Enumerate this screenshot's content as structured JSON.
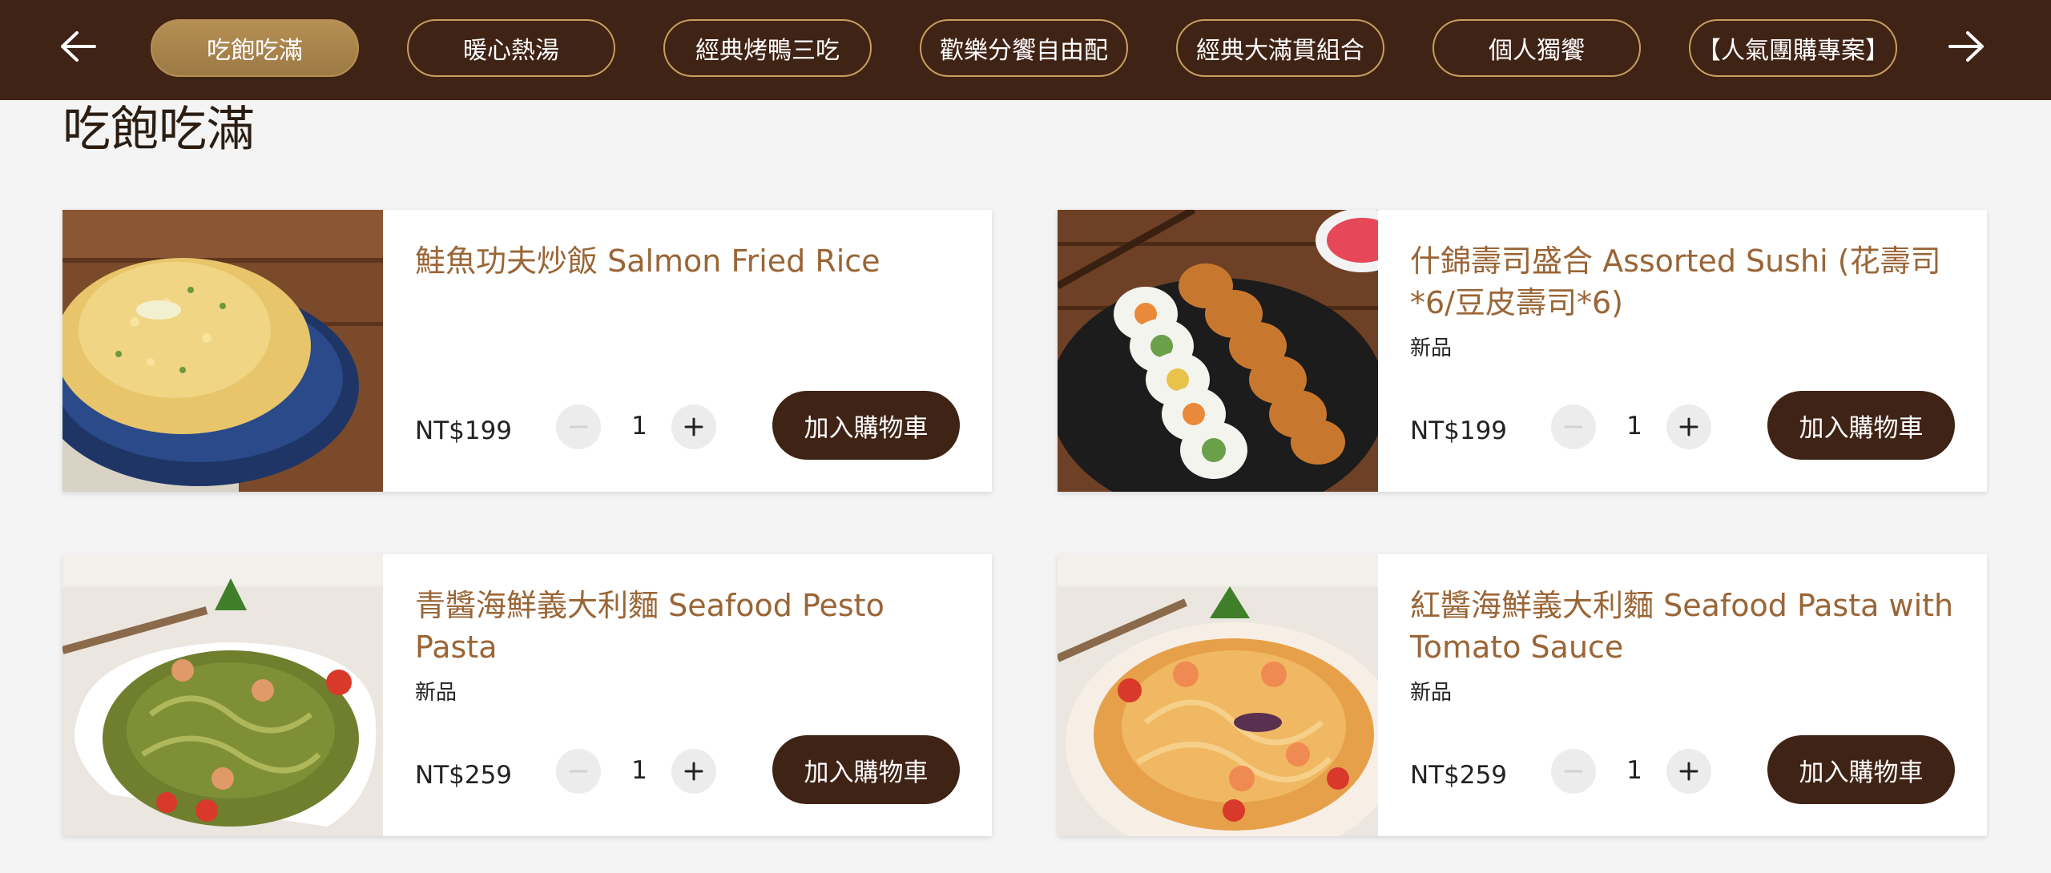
{
  "nav": {
    "prev_icon": "arrow-left-icon",
    "next_icon": "arrow-right-icon",
    "tabs": [
      {
        "label": "吃飽吃滿",
        "active": true
      },
      {
        "label": "暖心熱湯",
        "active": false
      },
      {
        "label": "經典烤鴨三吃",
        "active": false
      },
      {
        "label": "歡樂分饗自由配",
        "active": false
      },
      {
        "label": "經典大滿貫組合",
        "active": false
      },
      {
        "label": "個人獨饗",
        "active": false
      },
      {
        "label": "【人氣團購專案】",
        "active": false
      }
    ]
  },
  "section": {
    "title": "吃飽吃滿"
  },
  "products": [
    {
      "name": "鮭魚功夫炒飯 Salmon Fried Rice",
      "badge": "",
      "price": "NT$199",
      "quantity": "1",
      "add_label": "加入購物車",
      "image": "fried-rice-image"
    },
    {
      "name": "什錦壽司盛合 Assorted Sushi (花壽司*6/豆皮壽司*6)",
      "badge": "新品",
      "price": "NT$199",
      "quantity": "1",
      "add_label": "加入購物車",
      "image": "sushi-image"
    },
    {
      "name": "青醬海鮮義大利麵 Seafood Pesto Pasta",
      "badge": "新品",
      "price": "NT$259",
      "quantity": "1",
      "add_label": "加入購物車",
      "image": "pesto-pasta-image"
    },
    {
      "name": "紅醬海鮮義大利麵 Seafood Pasta with Tomato Sauce",
      "badge": "新品",
      "price": "NT$259",
      "quantity": "1",
      "add_label": "加入購物車",
      "image": "tomato-pasta-image"
    }
  ],
  "colors": {
    "header_bg": "#3f2315",
    "accent_gold": "#b58f54",
    "product_name": "#9a6536",
    "page_bg": "#f4f4f4"
  }
}
